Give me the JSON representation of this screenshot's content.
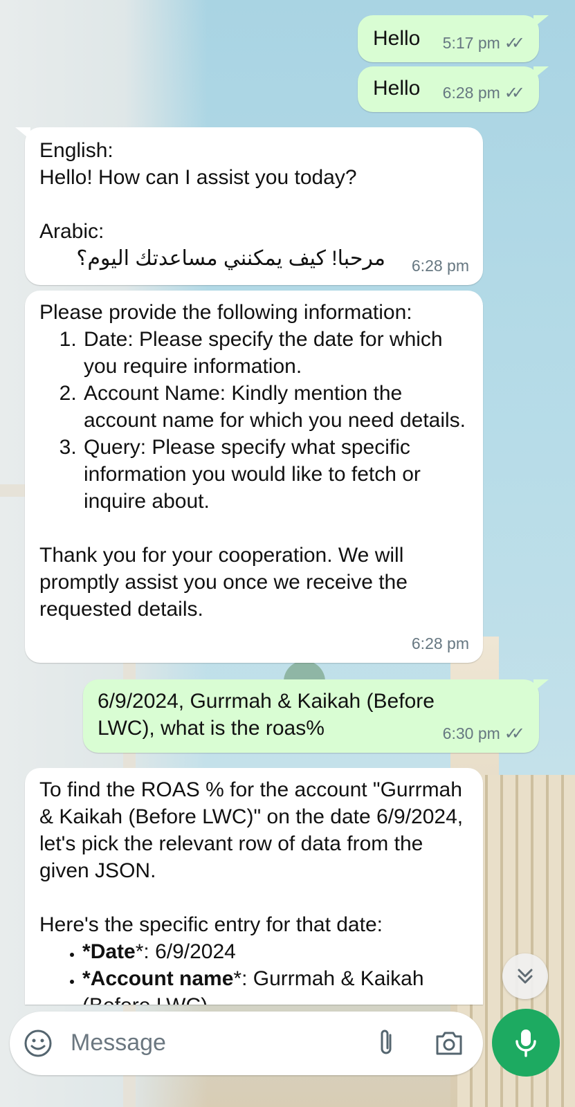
{
  "messages": [
    {
      "text": "Hello",
      "time": "5:17 pm"
    },
    {
      "text": "Hello",
      "time": "6:28 pm"
    },
    {
      "lines": [
        "English:",
        "Hello! How can I assist you today?",
        "",
        "Arabic:"
      ],
      "arabic": "مرحبا! كيف يمكنني مساعدتك اليوم؟",
      "time": "6:28 pm"
    },
    {
      "intro": "Please provide the following information:",
      "items": [
        "Date: Please specify the date for which you require information.",
        "Account Name: Kindly mention the account name for which you need details.",
        "Query: Please specify what specific information you would like to fetch or inquire about."
      ],
      "outro": "Thank you for your cooperation. We will promptly assist you once we receive the requested details.",
      "time": "6:28 pm"
    },
    {
      "text": "6/9/2024, Gurrmah & Kaikah (Before LWC), what is the roas%",
      "time": "6:30 pm"
    },
    {
      "para": "To find the ROAS % for the account \"Gurrmah & Kaikah (Before LWC)\" on the date 6/9/2024, let's pick the relevant row of data from the given JSON.",
      "intro2": "Here's the specific entry for that date:",
      "bullets": [
        {
          "prefix": "*",
          "key": "Date",
          "suffix": "*: 6/9/2024"
        },
        {
          "prefix": "*",
          "key": "Account name",
          "suffix": "*: Gurrmah & Kaikah (Before LWC)"
        }
      ]
    }
  ],
  "composer": {
    "placeholder": "Message"
  },
  "icons": {
    "emoji": "emoji-icon",
    "attach": "paperclip-icon",
    "camera": "camera-icon",
    "mic": "microphone-icon",
    "scroll": "double-chevron-down-icon",
    "read": "double-check-icon"
  },
  "colors": {
    "outgoing_bubble": "#d9fdd3",
    "incoming_bubble": "#ffffff",
    "mic_button": "#1daa61",
    "meta_text": "#667781"
  }
}
